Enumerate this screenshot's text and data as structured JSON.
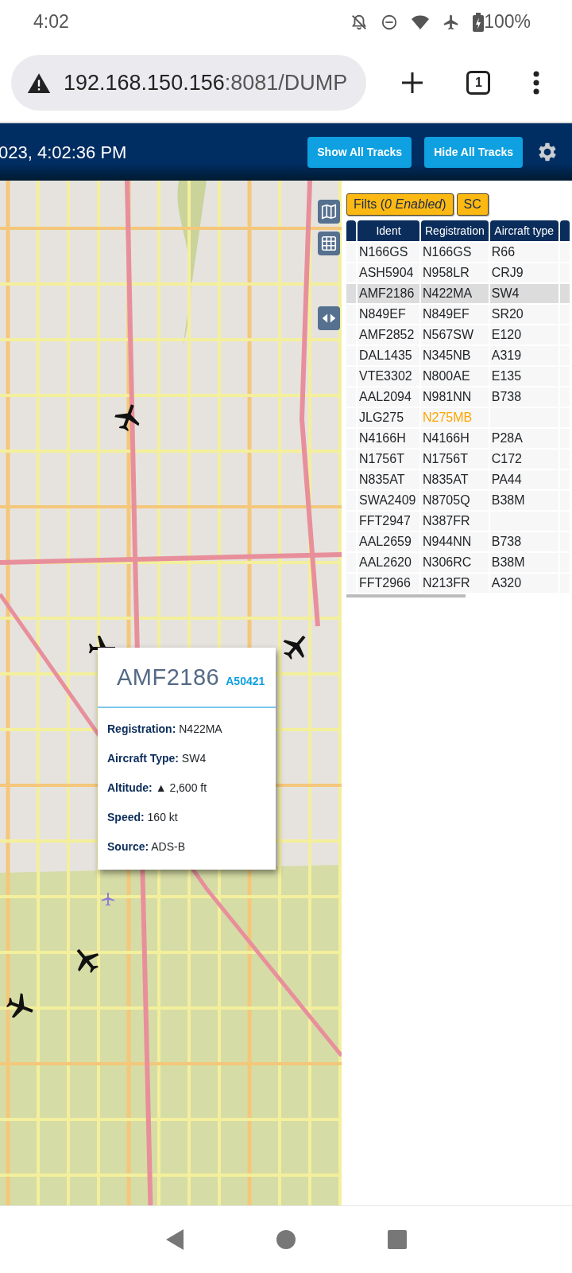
{
  "status_bar": {
    "time": "4:02",
    "battery": "100%"
  },
  "browser": {
    "url_host": "192.168.150.156",
    "url_rest": ":8081/DUMP",
    "tab_count": "1"
  },
  "header": {
    "timestamp": "023, 4:02:36 PM",
    "buttons": [
      "Show All Tracks",
      "Hide All Tracks"
    ]
  },
  "map": {
    "aircraft": [
      {
        "kind": "plane"
      },
      {
        "kind": "plane"
      },
      {
        "kind": "plane"
      },
      {
        "kind": "plane"
      },
      {
        "kind": "plane"
      },
      {
        "kind": "small"
      }
    ]
  },
  "popup": {
    "ident": "AMF2186",
    "hex": "A50421",
    "fields": [
      {
        "label": "Registration:",
        "value": "N422MA"
      },
      {
        "label": "Aircraft Type:",
        "value": "SW4"
      },
      {
        "label": "Altitude:",
        "value": "▲ 2,600 ft"
      },
      {
        "label": "Speed:",
        "value": "160 kt"
      },
      {
        "label": "Source:",
        "value": "ADS-B"
      }
    ]
  },
  "table_panel": {
    "filter_button": "Filts (*0 Enabled*)",
    "sc_button": "SC",
    "columns": [
      "Ident",
      "Registration",
      "Aircraft type"
    ],
    "rows": [
      {
        "ident": "N166GS",
        "registration": "N166GS",
        "type": "R66",
        "color": "#212529",
        "selected": false
      },
      {
        "ident": "ASH5904",
        "registration": "N958LR",
        "type": "CRJ9",
        "color": "#212529",
        "selected": false
      },
      {
        "ident": "AMF2186",
        "registration": "N422MA",
        "type": "SW4",
        "color": "#212529",
        "selected": true
      },
      {
        "ident": "N849EF",
        "registration": "N849EF",
        "type": "SR20",
        "color": "#212529",
        "selected": false
      },
      {
        "ident": "AMF2852",
        "registration": "N567SW",
        "type": "E120",
        "color": "#212529",
        "selected": false
      },
      {
        "ident": "DAL1435",
        "registration": "N345NB",
        "type": "A319",
        "color": "#212529",
        "selected": false
      },
      {
        "ident": "VTE3302",
        "registration": "N800AE",
        "type": "E135",
        "color": "#212529",
        "selected": false
      },
      {
        "ident": "AAL2094",
        "registration": "N981NN",
        "type": "B738",
        "color": "#212529",
        "selected": false
      },
      {
        "ident": "JLG275",
        "registration": "N275MB",
        "type": "",
        "color": "#ffa500",
        "selected": false
      },
      {
        "ident": "N4166H",
        "registration": "N4166H",
        "type": "P28A",
        "color": "#212529",
        "selected": false
      },
      {
        "ident": "N1756T",
        "registration": "N1756T",
        "type": "C172",
        "color": "#212529",
        "selected": false
      },
      {
        "ident": "N835AT",
        "registration": "N835AT",
        "type": "PA44",
        "color": "#212529",
        "selected": false
      },
      {
        "ident": "SWA2409",
        "registration": "N8705Q",
        "type": "B38M",
        "color": "#212529",
        "selected": false
      },
      {
        "ident": "FFT2947",
        "registration": "N387FR",
        "type": "",
        "color": "#212529",
        "selected": false
      },
      {
        "ident": "AAL2659",
        "registration": "N944NN",
        "type": "B738",
        "color": "#212529",
        "selected": false
      },
      {
        "ident": "AAL2620",
        "registration": "N306RC",
        "type": "B38M",
        "color": "#212529",
        "selected": false
      },
      {
        "ident": "FFT2966",
        "registration": "N213FR",
        "type": "A320",
        "color": "#212529",
        "selected": false
      }
    ]
  }
}
